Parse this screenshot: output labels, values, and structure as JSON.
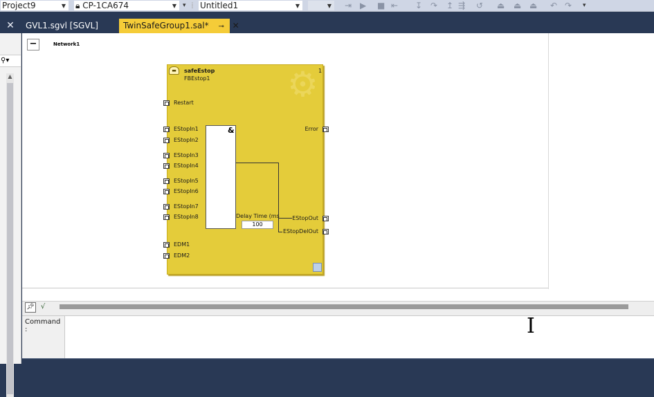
{
  "toolbar": {
    "project_combo": "Project9",
    "target_combo": "CP-1CA674",
    "config_combo": "Untitled1"
  },
  "tabs": [
    {
      "label": "GVL1.sgvl [SGVL]",
      "active": false
    },
    {
      "label": "TwinSafeGroup1.sal*",
      "active": true
    }
  ],
  "network": {
    "collapse_label": "−",
    "title": "Network1"
  },
  "function_block": {
    "type_name": "safeEstop",
    "instance_name": "FBEstop1",
    "number": "1",
    "inputs": [
      "Restart",
      "EStopIn1",
      "EStopIn2",
      "EStopIn3",
      "EStopIn4",
      "EStopIn5",
      "EStopIn6",
      "EStopIn7",
      "EStopIn8",
      "EDM1",
      "EDM2"
    ],
    "outputs": [
      "Error",
      "EStopOut",
      "EStopDelOut"
    ],
    "and_symbol": "&",
    "delay_label": "Delay Time (ms",
    "delay_value": "100"
  },
  "command": {
    "label": "Command :",
    "value": ""
  },
  "colors": {
    "fb_fill": "#e4cc3a",
    "active_tab": "#f5cc38",
    "chrome": "#293955"
  }
}
